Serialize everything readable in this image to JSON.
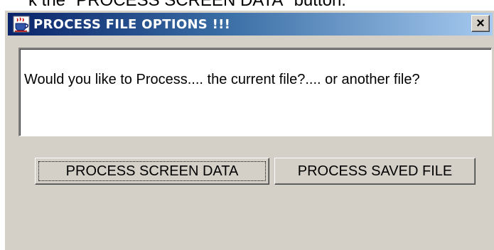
{
  "caption": {
    "text": "k the \"PROCESS SCREEN DATA\" button."
  },
  "window": {
    "title": "PROCESS FILE OPTIONS !!!",
    "icon": "java-coffee-cup-icon",
    "close_glyph": "×"
  },
  "message": {
    "text": "Would you like to Process.... the current file?....   or another file?"
  },
  "buttons": {
    "process_screen": "PROCESS SCREEN DATA",
    "process_saved": "PROCESS SAVED FILE"
  },
  "colors": {
    "dialog_bg": "#d4d0c8",
    "title_start": "#0a246a",
    "title_end": "#a6caf0"
  }
}
